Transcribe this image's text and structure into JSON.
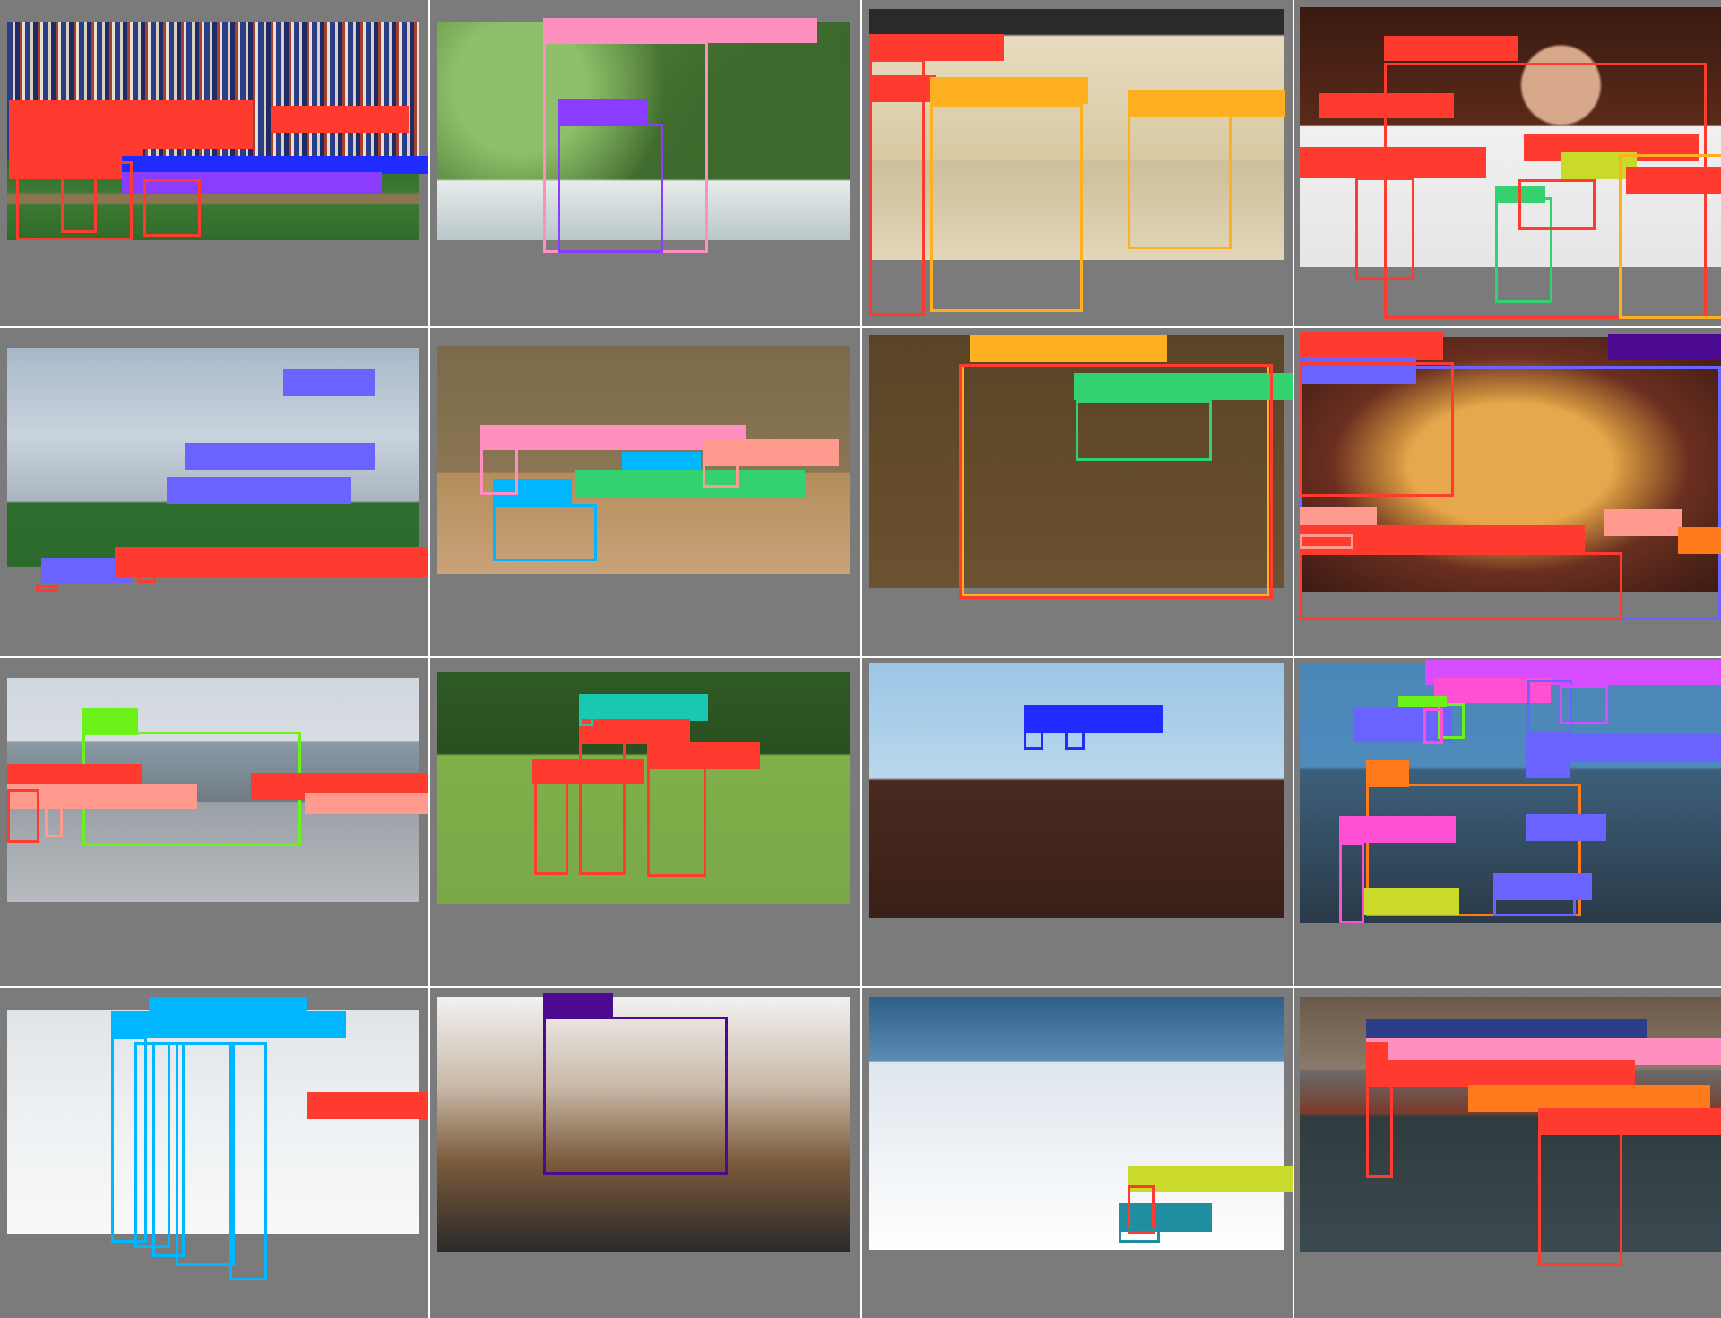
{
  "panels": [
    {
      "name": "panel-baseball-game",
      "bg": "p-baseball"
    },
    {
      "name": "panel-flower-vase",
      "bg": "p-flowers"
    },
    {
      "name": "panel-giraffes",
      "bg": "p-giraffe"
    },
    {
      "name": "panel-smiling-man",
      "bg": "p-man"
    },
    {
      "name": "panel-field-sky",
      "bg": "p-field"
    },
    {
      "name": "panel-room-sink",
      "bg": "p-room"
    },
    {
      "name": "panel-laptop",
      "bg": "p-laptop"
    },
    {
      "name": "panel-pizza",
      "bg": "p-pizza"
    },
    {
      "name": "panel-bus",
      "bg": "p-bus"
    },
    {
      "name": "panel-frisbee-players",
      "bg": "p-frisbee"
    },
    {
      "name": "panel-clock-tower",
      "bg": "p-clock"
    },
    {
      "name": "panel-desk-computer",
      "bg": "p-desk"
    },
    {
      "name": "panel-snowboards",
      "bg": "p-ski"
    },
    {
      "name": "panel-dog-shoes",
      "bg": "p-shoes"
    },
    {
      "name": "panel-snow-mountain",
      "bg": "p-mountain"
    },
    {
      "name": "panel-tennis-court",
      "bg": "p-tennis"
    }
  ],
  "colors": {
    "red": "#ff3b30",
    "pink": "#ff8fbf",
    "purple": "#8a3dff",
    "violet": "#6a63ff",
    "orange": "#ffb020",
    "green": "#33d16f",
    "lime": "#c9da2b",
    "navy": "#2a3e8a",
    "blue": "#1f2bff",
    "cyan": "#00b6ff",
    "salmon": "#ff9a8f",
    "teal": "#18c9b0",
    "brightgreen": "#6bf21b",
    "magenta": "#d84cff",
    "hotpink": "#ff4fd2",
    "darkorange": "#ff7a1a",
    "darkpurple": "#4b0a8f",
    "tealblue": "#1f8ea0"
  }
}
